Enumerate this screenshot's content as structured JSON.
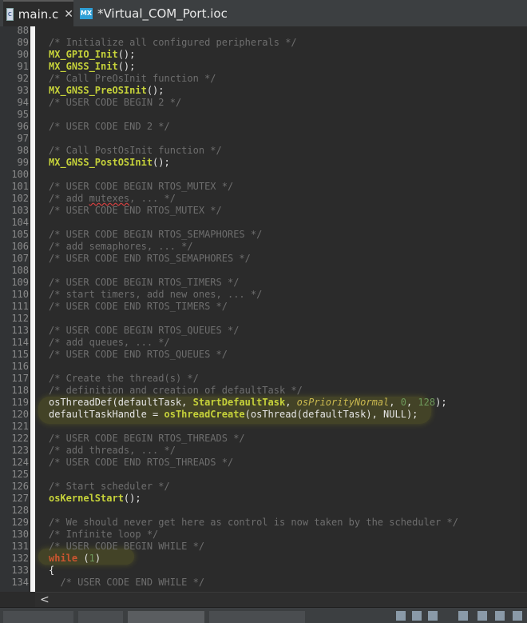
{
  "tabs": [
    {
      "label": "main.c",
      "icon": "c-file-icon",
      "active": true
    },
    {
      "label": "*Virtual_COM_Port.ioc",
      "icon": "mx-file-icon",
      "active": false
    }
  ],
  "line_numbers": [
    "88",
    "89",
    "90",
    "91",
    "92",
    "93",
    "94",
    "95",
    "96",
    "97",
    "98",
    "99",
    "100",
    "101",
    "102",
    "103",
    "104",
    "105",
    "106",
    "107",
    "108",
    "109",
    "110",
    "111",
    "112",
    "113",
    "114",
    "115",
    "116",
    "117",
    "118",
    "119",
    "120",
    "121",
    "122",
    "123",
    "124",
    "125",
    "126",
    "127",
    "128",
    "129",
    "130",
    "131",
    "132",
    "133",
    "134"
  ],
  "code": {
    "l89": "/* Initialize all configured peripherals */",
    "l90": "MX_GPIO_Init",
    "l91": "MX_GNSS_Init",
    "l92": "/* Call PreOsInit function */",
    "l93": "MX_GNSS_PreOSInit",
    "l94": "/* USER CODE BEGIN 2 */",
    "l96": "/* USER CODE END 2 */",
    "l98": "/* Call PostOsInit function */",
    "l99": "MX_GNSS_PostOSInit",
    "l101": "/* USER CODE BEGIN RTOS_MUTEX */",
    "l102a": "/* add ",
    "l102b": "mutexes",
    "l102c": ", ... */",
    "l103": "/* USER CODE END RTOS_MUTEX */",
    "l105": "/* USER CODE BEGIN RTOS_SEMAPHORES */",
    "l106": "/* add semaphores, ... */",
    "l107": "/* USER CODE END RTOS_SEMAPHORES */",
    "l109": "/* USER CODE BEGIN RTOS_TIMERS */",
    "l110": "/* start timers, add new ones, ... */",
    "l111": "/* USER CODE END RTOS_TIMERS */",
    "l113": "/* USER CODE BEGIN RTOS_QUEUES */",
    "l114": "/* add queues, ... */",
    "l115": "/* USER CODE END RTOS_QUEUES */",
    "l117": "/* Create the thread(s) */",
    "l118": "/* definition and creation of defaultTask */",
    "l119a": "osThreadDef(defaultTask, ",
    "l119b": "StartDefaultTask",
    "l119c": ", ",
    "l119d": "osPriorityNormal",
    "l119e": ", ",
    "l119f": "0",
    "l119g": ", ",
    "l119h": "128",
    "l119i": ");",
    "l120a": "defaultTaskHandle = ",
    "l120b": "osThreadCreate",
    "l120c": "(osThread(defaultTask), NULL);",
    "l122": "/* USER CODE BEGIN RTOS_THREADS */",
    "l123": "/* add threads, ... */",
    "l124": "/* USER CODE END RTOS_THREADS */",
    "l126": "/* Start scheduler */",
    "l127": "osKernelStart",
    "l129": "/* We should never get here as control is now taken by the scheduler */",
    "l130": "/* Infinite loop */",
    "l131": "/* USER CODE BEGIN WHILE */",
    "l132a": "while",
    "l132b": " (",
    "l132c": "1",
    "l132d": ")",
    "l133": "{",
    "l134": "  /* USER CODE END WHILE */",
    "call_suffix": "();"
  },
  "scroll_left_glyph": "<",
  "colors": {
    "comment": "#6e6e6e",
    "function": "#c6d23a",
    "keyword": "#cc5530",
    "constant_italic": "#c9b84f",
    "number": "#6e9a5c",
    "highlight": "#dcdc14"
  }
}
